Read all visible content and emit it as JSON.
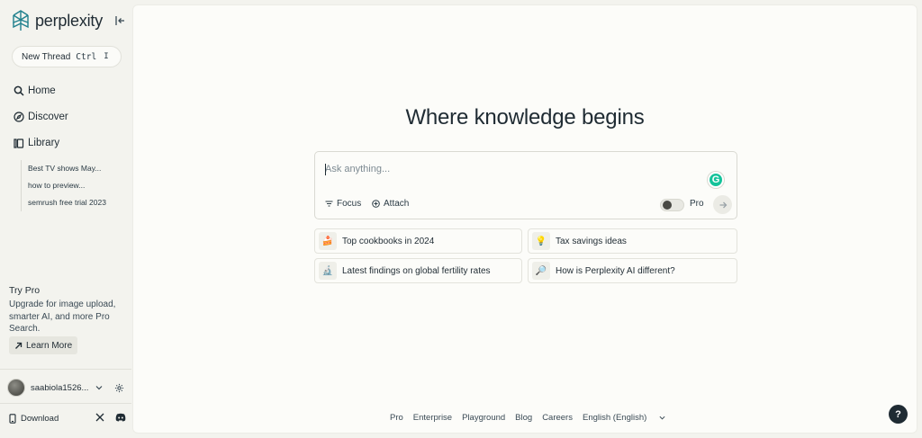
{
  "app": {
    "name": "perplexity"
  },
  "sidebar": {
    "new_thread": {
      "label": "New Thread",
      "shortcut_key1": "Ctrl",
      "shortcut_key2": "I"
    },
    "nav": [
      {
        "label": "Home",
        "icon": "search-icon"
      },
      {
        "label": "Discover",
        "icon": "compass-icon"
      },
      {
        "label": "Library",
        "icon": "library-icon"
      }
    ],
    "library": [
      "Best TV shows May...",
      "how to preview...",
      "semrush free trial 2023"
    ],
    "try_pro": {
      "title": "Try Pro",
      "description": "Upgrade for image upload, smarter AI, and more Pro Search.",
      "button": "Learn More"
    },
    "user": {
      "name": "saabiola1526..."
    },
    "download": "Download"
  },
  "main": {
    "headline": "Where knowledge begins",
    "search": {
      "placeholder": "Ask anything...",
      "focus": "Focus",
      "attach": "Attach",
      "pro_label": "Pro",
      "pro_enabled": false
    },
    "suggestions": [
      {
        "label": "Top cookbooks in 2024",
        "icon": "cake-icon"
      },
      {
        "label": "Tax savings ideas",
        "icon": "lightbulb-icon"
      },
      {
        "label": "Latest findings on global fertility rates",
        "icon": "microscope-icon"
      },
      {
        "label": "How is Perplexity AI different?",
        "icon": "magnifier-icon"
      }
    ],
    "footer": [
      "Pro",
      "Enterprise",
      "Playground",
      "Blog",
      "Careers",
      "English (English)"
    ],
    "help": "?"
  },
  "colors": {
    "accent": "#1f2b33",
    "background": "#f3f3ee",
    "panel": "#fcfcf9",
    "grammarly": "#15c39a"
  }
}
